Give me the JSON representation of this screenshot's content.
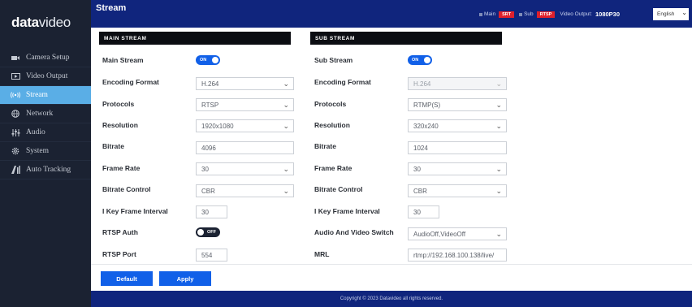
{
  "brand": {
    "logo_bold": "data",
    "logo_light": "video"
  },
  "sidebar": {
    "items": [
      {
        "label": "Camera Setup",
        "icon": "camera-icon"
      },
      {
        "label": "Video Output",
        "icon": "video-output-icon"
      },
      {
        "label": "Stream",
        "icon": "stream-icon",
        "active": true
      },
      {
        "label": "Network",
        "icon": "globe-icon"
      },
      {
        "label": "Audio",
        "icon": "audio-mixer-icon"
      },
      {
        "label": "System",
        "icon": "gear-icon"
      },
      {
        "label": "Auto Tracking",
        "icon": "auto-tracking-icon"
      }
    ]
  },
  "header": {
    "title": "Stream",
    "status": {
      "main_label": "Main",
      "main_badge": "SRT",
      "sub_label": "Sub",
      "sub_badge": "RTSP",
      "video_output_label": "Video Output:",
      "video_output_value": "1080P30"
    },
    "language": "English"
  },
  "main_stream": {
    "header": "MAIN STREAM",
    "rows": [
      {
        "label": "Main Stream",
        "type": "toggle",
        "value": "ON",
        "on": true
      },
      {
        "label": "Encoding Format",
        "type": "select",
        "value": "H.264"
      },
      {
        "label": "Protocols",
        "type": "select",
        "value": "RTSP"
      },
      {
        "label": "Resolution",
        "type": "select",
        "value": "1920x1080"
      },
      {
        "label": "Bitrate",
        "type": "input",
        "value": "4096"
      },
      {
        "label": "Frame Rate",
        "type": "select",
        "value": "30"
      },
      {
        "label": "Bitrate Control",
        "type": "select",
        "value": "CBR"
      },
      {
        "label": "I Key Frame Interval",
        "type": "input",
        "value": "30"
      },
      {
        "label": "RTSP Auth",
        "type": "toggle",
        "value": "OFF",
        "on": false
      },
      {
        "label": "RTSP Port",
        "type": "input",
        "value": "554"
      }
    ]
  },
  "sub_stream": {
    "header": "SUB STREAM",
    "rows": [
      {
        "label": "Sub Stream",
        "type": "toggle",
        "value": "ON",
        "on": true
      },
      {
        "label": "Encoding Format",
        "type": "select",
        "value": "H.264",
        "disabled": true
      },
      {
        "label": "Protocols",
        "type": "select",
        "value": "RTMP(S)"
      },
      {
        "label": "Resolution",
        "type": "select",
        "value": "320x240"
      },
      {
        "label": "Bitrate",
        "type": "input",
        "value": "1024"
      },
      {
        "label": "Frame Rate",
        "type": "select",
        "value": "30"
      },
      {
        "label": "Bitrate Control",
        "type": "select",
        "value": "CBR"
      },
      {
        "label": "I Key Frame Interval",
        "type": "input",
        "value": "30"
      },
      {
        "label": "Audio And Video Switch",
        "type": "select",
        "value": "AudioOff,VideoOff"
      },
      {
        "label": "MRL",
        "type": "input",
        "value": "rtmp://192.168.100.138/live/"
      }
    ]
  },
  "buttons": {
    "default_label": "Default",
    "apply_label": "Apply"
  },
  "footer": {
    "text": "Copyright © 2023 Datavideo all rights reserved."
  },
  "colors": {
    "topbar": "#10257d",
    "sidebar": "#1b2232",
    "accent": "#1160e8",
    "active_nav": "#5aaee6",
    "badge": "#e0202c"
  }
}
